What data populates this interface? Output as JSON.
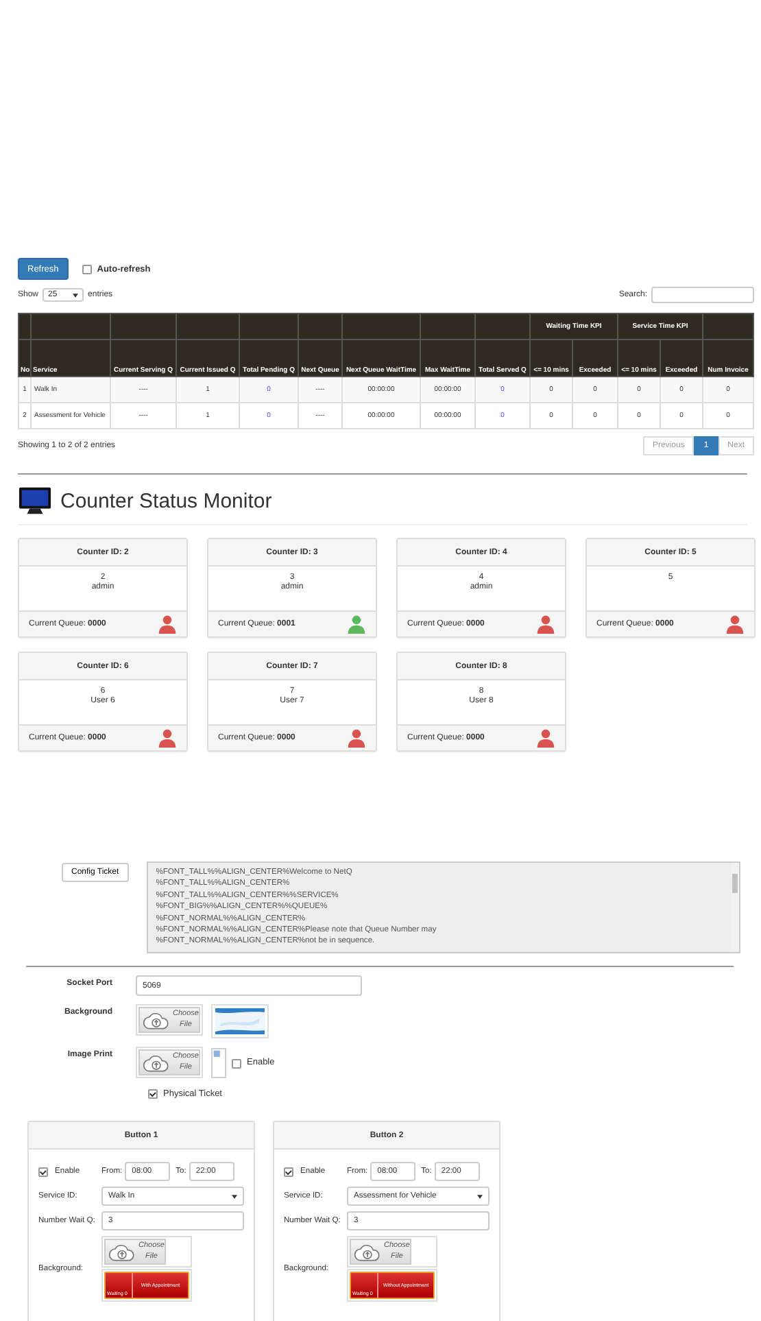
{
  "toolbar": {
    "refresh": "Refresh",
    "auto_refresh": {
      "label": "Auto-refresh",
      "checked": false
    }
  },
  "length": {
    "show": "Show",
    "value": "25",
    "entries": "entries"
  },
  "search": {
    "label": "Search:"
  },
  "table": {
    "columns": [
      {
        "label": "No"
      },
      {
        "label": "Service"
      },
      {
        "label": "Current Serving Q"
      },
      {
        "label": "Current Issued Q"
      },
      {
        "label": "Total Pending Q",
        "kind": "link"
      },
      {
        "label": "Next Queue"
      },
      {
        "label": "Next Queue WaitTime"
      },
      {
        "label": "Max WaitTime"
      },
      {
        "label": "Total Served Q",
        "kind": "link"
      },
      {
        "label": "Waiting Time KPI",
        "colspan": 2,
        "columns": [
          {
            "label": "<= 10 mins"
          },
          {
            "label": "Exceeded"
          }
        ]
      },
      {
        "label": "Service Time KPI",
        "colspan": 2,
        "columns": [
          {
            "label": "<= 10 mins"
          },
          {
            "label": "Exceeded"
          }
        ]
      },
      {
        "label": "Num Invoice"
      }
    ],
    "rows": [
      [
        "1",
        "Walk In",
        "----",
        "1",
        "0",
        "----",
        "00:00:00",
        "00:00:00",
        "0",
        "0",
        "0",
        "0",
        "0",
        "0"
      ],
      [
        "2",
        "Assessment for Vehicle",
        "----",
        "1",
        "0",
        "----",
        "00:00:00",
        "00:00:00",
        "0",
        "0",
        "0",
        "0",
        "0",
        "0"
      ]
    ]
  },
  "table_info": "Showing 1 to 2 of 2 entries",
  "pagination": [
    {
      "label": "Previous",
      "selected": false
    },
    {
      "label": "1",
      "selected": true
    },
    {
      "label": "Next",
      "selected": false
    }
  ],
  "monitor": {
    "title": "Counter Status Monitor",
    "counters": [
      {
        "title": "Counter ID: 2",
        "number": "2",
        "user": "admin",
        "queue_label": "Current Queue:",
        "queue": "0000",
        "color": "#d9534f"
      },
      {
        "title": "Counter ID: 3",
        "number": "3",
        "user": "admin",
        "queue_label": "Current Queue:",
        "queue": "0001",
        "color": "#5cb85c"
      },
      {
        "title": "Counter ID: 4",
        "number": "4",
        "user": "admin",
        "queue_label": "Current Queue:",
        "queue": "0000",
        "color": "#d9534f"
      },
      {
        "title": "Counter ID: 5",
        "number": "5",
        "queue_label": "Current Queue:",
        "queue": "0000",
        "color": "#d9534f"
      },
      {
        "title": "Counter ID: 6",
        "number": "6",
        "user": "User 6",
        "queue_label": "Current Queue:",
        "queue": "0000",
        "color": "#d9534f"
      },
      {
        "title": "Counter ID: 7",
        "number": "7",
        "user": "User 7",
        "queue_label": "Current Queue:",
        "queue": "0000",
        "color": "#d9534f"
      },
      {
        "title": "Counter ID: 8",
        "number": "8",
        "user": "User 8",
        "queue_label": "Current Queue:",
        "queue": "0000",
        "color": "#d9534f"
      }
    ]
  },
  "config": {
    "button": "Config Ticket",
    "lines": [
      "%FONT_TALL%%ALIGN_CENTER%Welcome to NetQ",
      "%FONT_TALL%%ALIGN_CENTER%",
      "%FONT_TALL%%ALIGN_CENTER%%SERVICE%",
      "%FONT_BIG%%ALIGN_CENTER%%QUEUE%",
      "%FONT_NORMAL%%ALIGN_CENTER%",
      "%FONT_NORMAL%%ALIGN_CENTER%Please note that Queue Number may",
      "%FONT_NORMAL%%ALIGN_CENTER%not be in sequence."
    ]
  },
  "settings": {
    "socket_port": {
      "label": "Socket Port",
      "value": "5069"
    },
    "background": {
      "label": "Background",
      "choose": "Choose File"
    },
    "image_print": {
      "label": "Image Print",
      "choose": "Choose File",
      "enable": {
        "label": "Enable",
        "checked": false
      }
    },
    "physical_ticket": {
      "label": "Physical Ticket",
      "checked": true
    }
  },
  "buttons": [
    {
      "title": "Button 1",
      "enable": {
        "label": "Enable",
        "checked": true
      },
      "from_label": "From:",
      "from": "08:00",
      "to_label": "To:",
      "to": "22:00",
      "service_label": "Service ID:",
      "service": "Walk In",
      "wait_label": "Number Wait Q:",
      "wait": "3",
      "background_label": "Background:",
      "choose": "Choose File",
      "preview_left": "Waiting 0",
      "preview_right": "With Appointment"
    },
    {
      "title": "Button 2",
      "enable": {
        "label": "Enable",
        "checked": true
      },
      "from_label": "From:",
      "from": "08:00",
      "to_label": "To:",
      "to": "22:00",
      "service_label": "Service ID:",
      "service": "Assessment for Vehicle",
      "wait_label": "Number Wait Q:",
      "wait": "3",
      "background_label": "Background:",
      "choose": "Choose File",
      "preview_left": "Waiting 0",
      "preview_right": "Without Appointment"
    }
  ]
}
